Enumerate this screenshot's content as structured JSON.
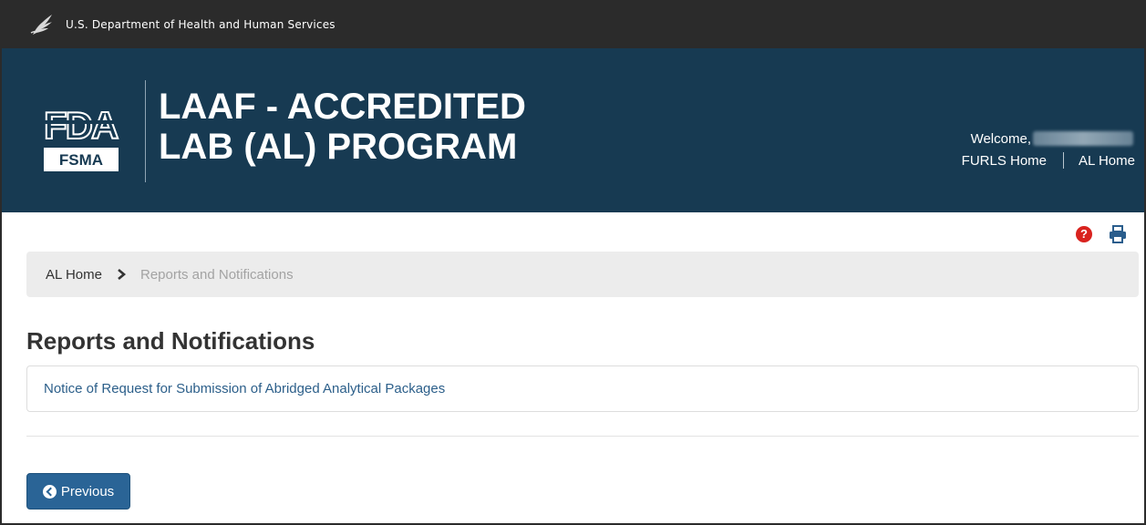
{
  "hhs_bar": {
    "text": "U.S. Department of Health and Human Services"
  },
  "banner": {
    "logo_text_top": "FDA",
    "logo_text_bottom": "FSMA",
    "title_line1": "LAAF - ACCREDITED",
    "title_line2": "LAB (AL) PROGRAM",
    "welcome_label": "Welcome,",
    "links": {
      "furls_home": "FURLS Home",
      "al_home": "AL Home"
    }
  },
  "utility": {
    "help_glyph": "?",
    "icons": [
      "question-circle-icon",
      "print-icon"
    ]
  },
  "breadcrumb": {
    "home": "AL Home",
    "current": "Reports and Notifications"
  },
  "main": {
    "title": "Reports and Notifications",
    "items": [
      {
        "label": "Notice of Request for Submission of Abridged Analytical Packages"
      }
    ],
    "previous_button": "Previous"
  },
  "colors": {
    "hhs_bar": "#2b2b2b",
    "banner": "#173a52",
    "link": "#2c5f8a",
    "button": "#2a6496",
    "help_icon": "#d9231f"
  }
}
